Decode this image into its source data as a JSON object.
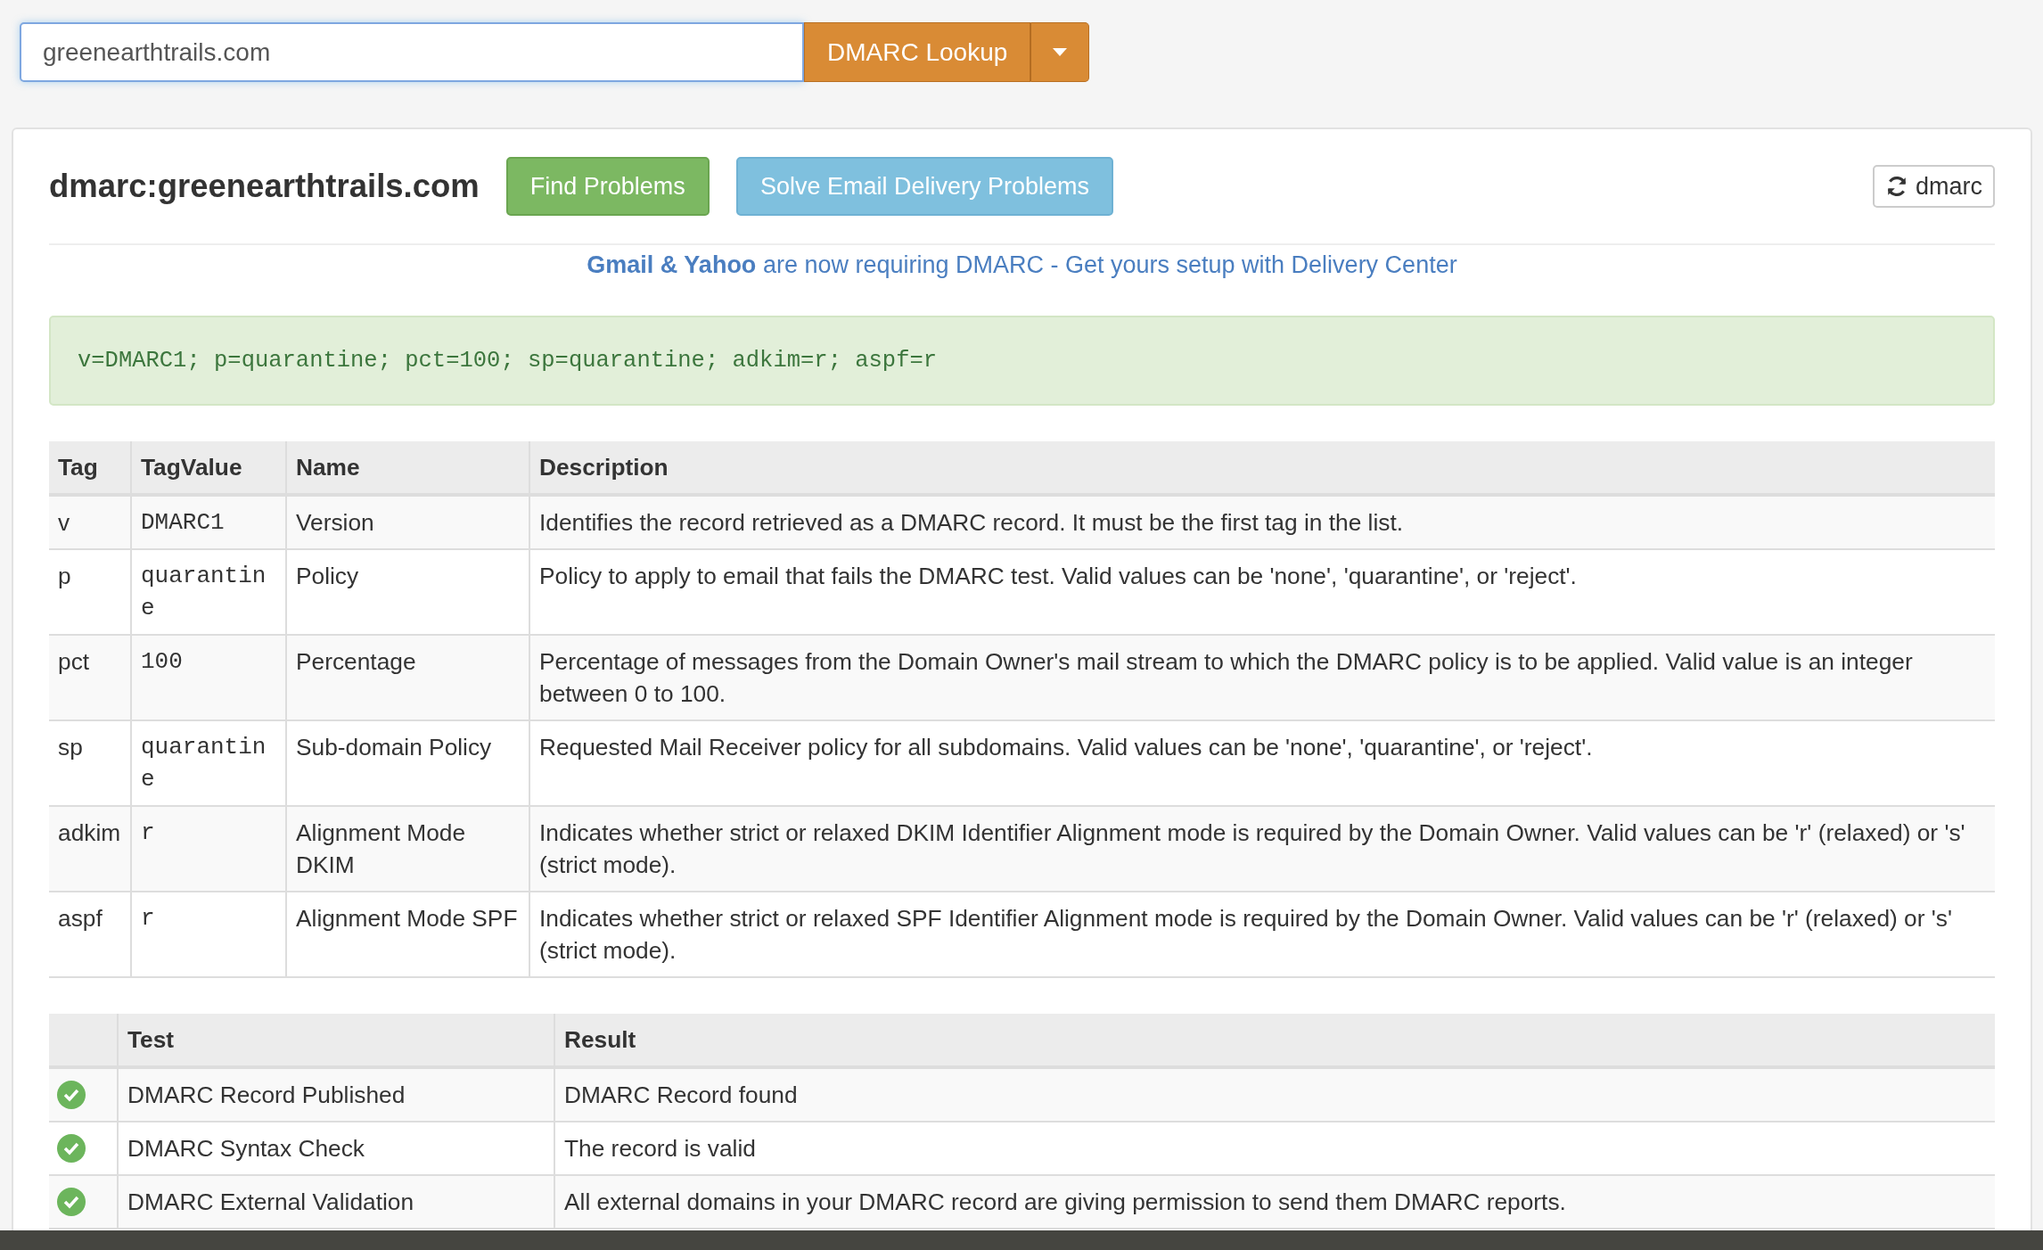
{
  "search": {
    "value": "greenearthtrails.com"
  },
  "lookup_button": {
    "label": "DMARC Lookup"
  },
  "result": {
    "title": "dmarc:greenearthtrails.com",
    "actions": [
      {
        "label": "Find Problems",
        "kind": "success"
      },
      {
        "label": "Solve Email Delivery Problems",
        "kind": "info"
      }
    ],
    "refresh_button": {
      "label": "dmarc"
    },
    "notice": "**Gmail & Yahoo** are now requiring DMARC - Get yours setup with Delivery Center",
    "record": "v=DMARC1; p=quarantine; pct=100; sp=quarantine; adkim=r; aspf=r",
    "tag_table": {
      "columns": [
        "Tag",
        "TagValue",
        "Name",
        "Description"
      ],
      "rows": [
        [
          "v",
          "DMARC1",
          "Version",
          "Identifies the record retrieved as a DMARC record. It must be the first tag in the list."
        ],
        [
          "p",
          "quarantine",
          "Policy",
          "Policy to apply to email that fails the DMARC test. Valid values can be 'none', 'quarantine', or 'reject'."
        ],
        [
          "pct",
          "100",
          "Percentage",
          "Percentage of messages from the Domain Owner's mail stream to which the DMARC policy is to be applied. Valid value is an integer between 0 to 100."
        ],
        [
          "sp",
          "quarantine",
          "Sub-domain Policy",
          "Requested Mail Receiver policy for all subdomains. Valid values can be 'none', 'quarantine', or 'reject'."
        ],
        [
          "adkim",
          "r",
          "Alignment Mode DKIM",
          "Indicates whether strict or relaxed DKIM Identifier Alignment mode is required by the Domain Owner. Valid values can be 'r' (relaxed) or 's' (strict mode)."
        ],
        [
          "aspf",
          "r",
          "Alignment Mode SPF",
          "Indicates whether strict or relaxed SPF Identifier Alignment mode is required by the Domain Owner. Valid values can be 'r' (relaxed) or 's' (strict mode)."
        ]
      ]
    },
    "test_table": {
      "columns": [
        "Test",
        "Result"
      ],
      "rows": [
        {
          "kind": "pass",
          "test": "DMARC Record Published",
          "result": "DMARC Record found"
        },
        {
          "kind": "pass",
          "test": "DMARC Syntax Check",
          "result": "The record is valid"
        },
        {
          "kind": "pass",
          "test": "DMARC External Validation",
          "result": "All external domains in your DMARC record are giving permission to send them DMARC reports."
        }
      ]
    }
  }
}
